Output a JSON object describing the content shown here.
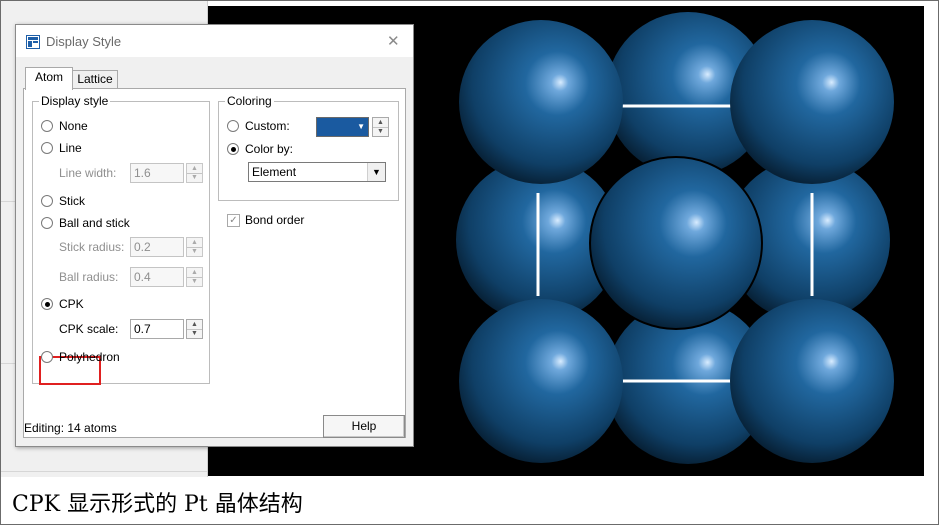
{
  "dialog": {
    "title": "Display Style",
    "tabs": [
      {
        "label": "Atom",
        "active": true
      },
      {
        "label": "Lattice",
        "active": false
      }
    ],
    "display_style": {
      "group_label": "Display style",
      "none_label": "None",
      "line_label": "Line",
      "line_width_label": "Line width:",
      "line_width_value": "1.6",
      "stick_label": "Stick",
      "ball_and_stick_label": "Ball and stick",
      "stick_radius_label": "Stick radius:",
      "stick_radius_value": "0.2",
      "ball_radius_label": "Ball radius:",
      "ball_radius_value": "0.4",
      "cpk_label": "CPK",
      "cpk_scale_label": "CPK scale:",
      "cpk_scale_value": "0.7",
      "polyhedron_label": "Polyhedron",
      "selected": "CPK"
    },
    "coloring": {
      "group_label": "Coloring",
      "custom_label": "Custom:",
      "custom_color": "#1a5aa0",
      "color_by_label": "Color by:",
      "color_by_value": "Element",
      "selected": "Color by"
    },
    "bond_order_label": "Bond order",
    "bond_order_checked": true,
    "status_text": "Editing: 14 atoms",
    "help_label": "Help"
  },
  "caption": "CPK 显示形式的 Pt 晶体结构",
  "colors": {
    "atom": "#1a5a8e",
    "bond": "#ffffff",
    "viewport_bg": "#000000",
    "highlight": "#e02020"
  },
  "icons": {
    "title": "window-icon",
    "close": "close-icon",
    "dropdown": "chevron-down-icon"
  }
}
